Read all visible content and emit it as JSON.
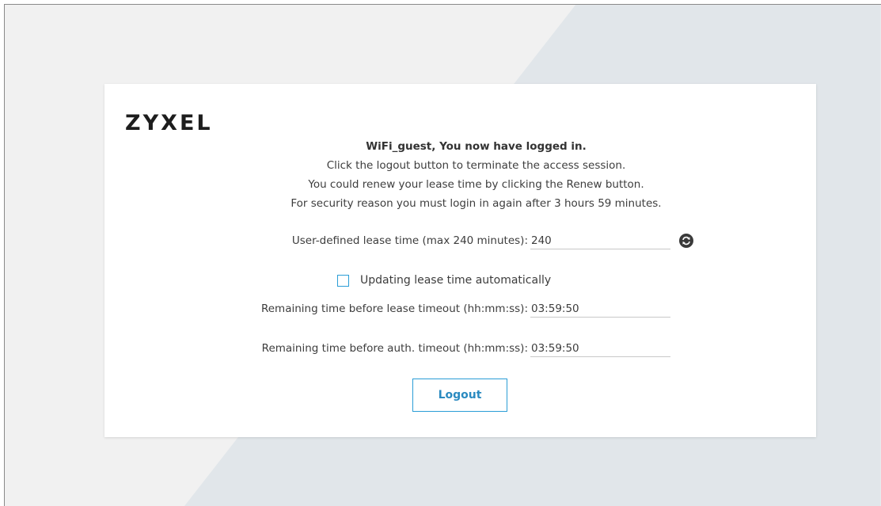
{
  "brand": {
    "logo_text": "ZYXEL"
  },
  "message": {
    "title": "WiFi_guest, You now have logged in.",
    "line1": "Click the logout button to terminate the access session.",
    "line2": "You could renew your lease time by clicking the Renew button.",
    "line3": "For security reason you must login in again after 3 hours 59 minutes."
  },
  "lease": {
    "label": "User-defined lease time (max 240 minutes):",
    "value": "240",
    "renew_icon": "refresh-icon"
  },
  "auto_update": {
    "label": "Updating lease time automatically",
    "checked": false
  },
  "remaining_lease": {
    "label": "Remaining time before lease timeout (hh:mm:ss):",
    "value": "03:59:50"
  },
  "remaining_auth": {
    "label": "Remaining time before auth. timeout (hh:mm:ss):",
    "value": "03:59:50"
  },
  "actions": {
    "logout_label": "Logout"
  },
  "colors": {
    "accent": "#2a9dd6",
    "background": "#f1f1f1",
    "background_shade": "#e1e6ea"
  }
}
